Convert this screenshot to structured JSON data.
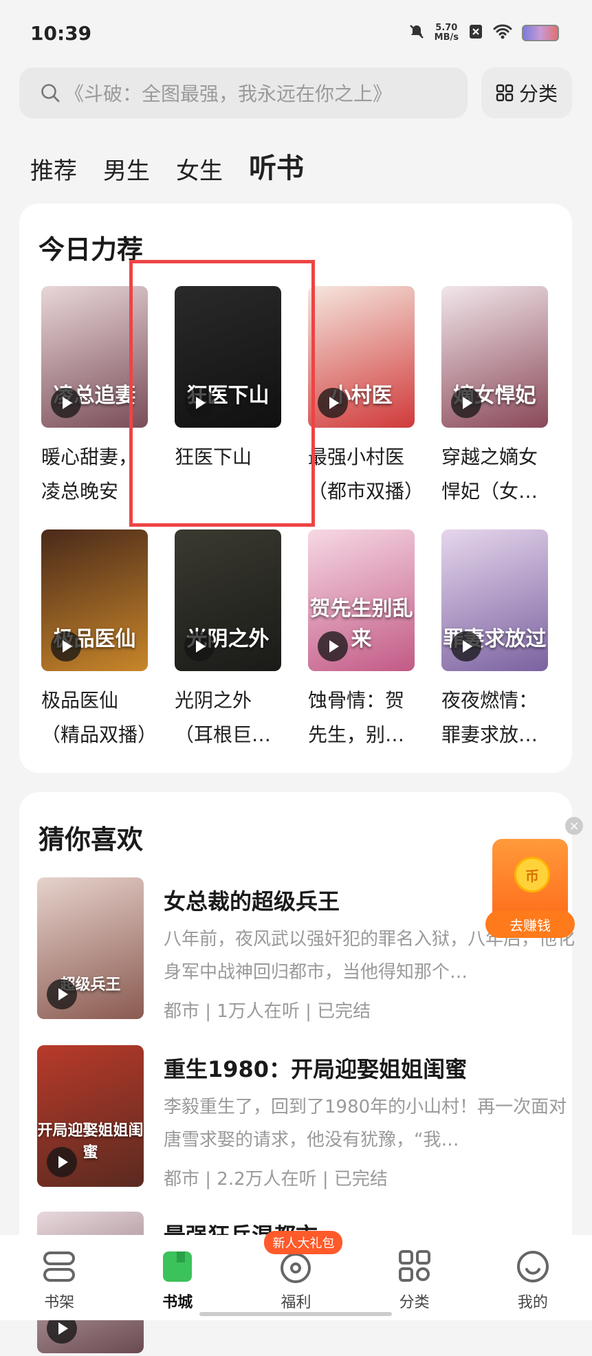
{
  "status_bar": {
    "time": "10:39",
    "speed_value": "5.70",
    "speed_unit": "MB/s"
  },
  "search": {
    "placeholder": "《斗破：全图最强，我永远在你之上》",
    "category_label": "分类"
  },
  "tabs": [
    {
      "label": "推荐",
      "active": false
    },
    {
      "label": "男生",
      "active": false
    },
    {
      "label": "女生",
      "active": false
    },
    {
      "label": "听书",
      "active": true
    }
  ],
  "today": {
    "title": "今日力荐",
    "items": [
      {
        "title": "暖心甜妻，\n凌总晚安",
        "cover_text": "凌总追妻",
        "colors": [
          "#e8d6d8",
          "#7a4d58"
        ]
      },
      {
        "title": "狂医下山",
        "cover_text": "狂医下山",
        "colors": [
          "#2a2a2a",
          "#101010"
        ]
      },
      {
        "title": "最强小村医\n（都市双播）",
        "cover_text": "小村医",
        "colors": [
          "#f5e6de",
          "#d03a3a"
        ]
      },
      {
        "title": "穿越之嫡女\n悍妃（女…",
        "cover_text": "嫡女悍妃",
        "colors": [
          "#f1e6ea",
          "#8a4858"
        ]
      },
      {
        "title": "极品医仙\n（精品双播）",
        "cover_text": "极品医仙",
        "colors": [
          "#4a2a1a",
          "#c8862a"
        ]
      },
      {
        "title": "光阴之外\n（耳根巨…",
        "cover_text": "光阴之外",
        "colors": [
          "#3a3a30",
          "#1a1a18"
        ]
      },
      {
        "title": "蚀骨情：贺\n先生，别…",
        "cover_text": "贺先生别乱来",
        "colors": [
          "#f6d8e4",
          "#c25a86"
        ]
      },
      {
        "title": "夜夜燃情：\n罪妻求放…",
        "cover_text": "罪妻求放过",
        "colors": [
          "#e6d6ec",
          "#7a62a0"
        ]
      }
    ]
  },
  "guess": {
    "title": "猜你喜欢",
    "items": [
      {
        "title": "女总裁的超级兵王",
        "desc": "八年前，夜风武以强奸犯的罪名入狱，八年后，他化身军中战神回归都市，当他得知那个…",
        "meta": "都市 | 1万人在听 | 已完结",
        "cover_text": "超级兵王",
        "colors": [
          "#e6d2cc",
          "#8a5a50"
        ]
      },
      {
        "title": "重生1980：开局迎娶姐姐闺蜜",
        "desc": "李毅重生了，回到了1980年的小山村！再一次面对唐雪求娶的请求，他没有犹豫，“我…",
        "meta": "都市 | 2.2万人在听 | 已完结",
        "cover_text": "开局迎娶姐姐闺蜜",
        "colors": [
          "#b83a2a",
          "#5a2a20"
        ]
      },
      {
        "title": "最强狂兵混都市",
        "desc": "",
        "meta": "",
        "cover_text": "",
        "colors": [
          "#e8d8dc",
          "#6a4a50"
        ]
      }
    ]
  },
  "earn": {
    "label": "去赚钱",
    "coin": "币"
  },
  "bottom_nav": [
    {
      "label": "书架",
      "icon": "bookshelf-icon",
      "active": false
    },
    {
      "label": "书城",
      "icon": "bookstore-icon",
      "active": true
    },
    {
      "label": "福利",
      "icon": "welfare-icon",
      "active": false,
      "badge": "新人大礼包"
    },
    {
      "label": "分类",
      "icon": "category-icon",
      "active": false
    },
    {
      "label": "我的",
      "icon": "profile-icon",
      "active": false
    }
  ],
  "colors": {
    "accent_green": "#3cc25a",
    "highlight_red": "#e44444",
    "earn_orange": "#ff7a1a"
  }
}
